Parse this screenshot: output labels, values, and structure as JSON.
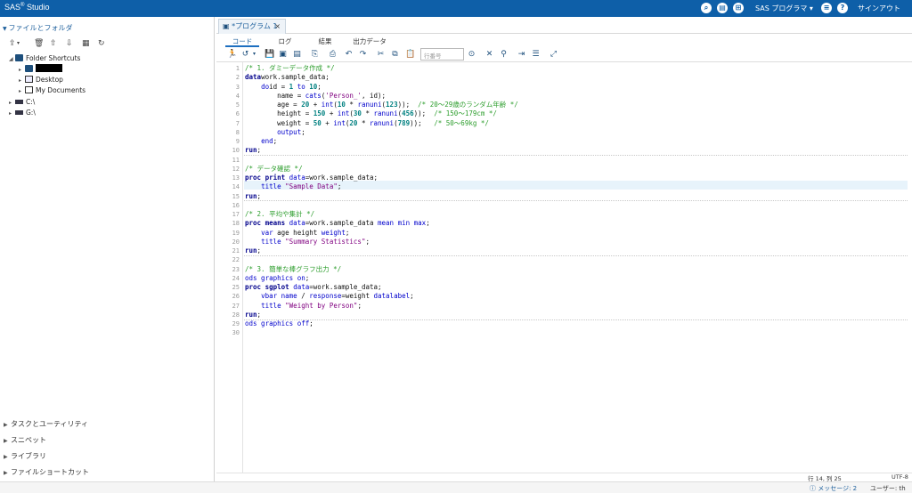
{
  "app": {
    "title": "SAS",
    "reg": "®",
    "title2": " Studio"
  },
  "top": {
    "program_menu": "SAS プログラマ ▾",
    "signout": "サインアウト",
    "icons": [
      "search-icon",
      "clipboard-icon",
      "grid-icon",
      "menu-icon",
      "help-icon"
    ]
  },
  "left": {
    "heading": "ファイルとフォルダ",
    "tree": {
      "folder_shortcuts": "Folder Shortcuts",
      "desktop": "Desktop",
      "my_documents": "My Documents",
      "c_drive": "C:\\",
      "g_drive": "G:\\"
    },
    "accordion": [
      "タスクとユーティリティ",
      "スニペット",
      "ライブラリ",
      "ファイルショートカット"
    ]
  },
  "editor_tab": {
    "title": "*プログラム 1",
    "close": "×"
  },
  "subtabs": [
    "コード",
    "ログ",
    "結果",
    "出力データ"
  ],
  "toolbar": {
    "line_placeholder": "行番号"
  },
  "status": {
    "position": "行 14, 列 25",
    "encoding": "UTF-8",
    "messages": "メッセージ: 2",
    "user": "ユーザー: th"
  },
  "code_lines": [
    [
      [
        "cm",
        "/* 1. ダミーデータ作成 */"
      ]
    ],
    [
      [
        "kw",
        "data"
      ],
      [
        "",
        "work.sample_data;"
      ]
    ],
    [
      [
        "",
        "    "
      ],
      [
        "kb",
        "do"
      ],
      [
        "",
        "id = "
      ],
      [
        "nm",
        "1"
      ],
      [
        "",
        ""
      ],
      [
        "kb",
        " to "
      ],
      [
        "nm",
        "10"
      ],
      [
        "",
        ";"
      ]
    ],
    [
      [
        "",
        "        name = "
      ],
      [
        "kb",
        "cats"
      ],
      [
        "",
        "("
      ],
      [
        "st",
        "'Person_'"
      ],
      [
        "",
        ", id);"
      ]
    ],
    [
      [
        "",
        "        age = "
      ],
      [
        "nm",
        "20"
      ],
      [
        "",
        " + "
      ],
      [
        "kb",
        "int"
      ],
      [
        "",
        "("
      ],
      [
        "nm",
        "10"
      ],
      [
        "",
        " * "
      ],
      [
        "kb",
        "ranuni"
      ],
      [
        "",
        "("
      ],
      [
        "nm",
        "123"
      ],
      [
        "",
        "));  "
      ],
      [
        "cm",
        "/* 20～29歳のランダム年齢 */"
      ]
    ],
    [
      [
        "",
        "        height = "
      ],
      [
        "nm",
        "150"
      ],
      [
        "",
        " + "
      ],
      [
        "kb",
        "int"
      ],
      [
        "",
        "("
      ],
      [
        "nm",
        "30"
      ],
      [
        "",
        " * "
      ],
      [
        "kb",
        "ranuni"
      ],
      [
        "",
        "("
      ],
      [
        "nm",
        "456"
      ],
      [
        "",
        "));  "
      ],
      [
        "cm",
        "/* 150～179cm */"
      ]
    ],
    [
      [
        "",
        "        weight = "
      ],
      [
        "nm",
        "50"
      ],
      [
        "",
        " + "
      ],
      [
        "kb",
        "int"
      ],
      [
        "",
        "("
      ],
      [
        "nm",
        "20"
      ],
      [
        "",
        " * "
      ],
      [
        "kb",
        "ranuni"
      ],
      [
        "",
        "("
      ],
      [
        "nm",
        "789"
      ],
      [
        "",
        "));   "
      ],
      [
        "cm",
        "/* 50～69kg */"
      ]
    ],
    [
      [
        "",
        "        "
      ],
      [
        "kb",
        "output"
      ],
      [
        "",
        ";"
      ]
    ],
    [
      [
        "",
        "    "
      ],
      [
        "kb",
        "end"
      ],
      [
        "",
        ";"
      ]
    ],
    [
      [
        "kw",
        "run"
      ],
      [
        "",
        ";"
      ]
    ],
    [
      [
        "",
        ""
      ]
    ],
    [
      [
        "cm",
        "/* データ確認 */"
      ]
    ],
    [
      [
        "kw",
        "proc print"
      ],
      [
        "",
        " "
      ],
      [
        "kb",
        "data"
      ],
      [
        "",
        "=work.sample_data;"
      ]
    ],
    [
      [
        "",
        "    "
      ],
      [
        "kb",
        "title"
      ],
      [
        "",
        " "
      ],
      [
        "st",
        "\"Sample Data\""
      ],
      [
        "",
        ";"
      ]
    ],
    [
      [
        "kw",
        "run"
      ],
      [
        "",
        ";"
      ]
    ],
    [
      [
        "",
        ""
      ]
    ],
    [
      [
        "cm",
        "/* 2. 平均や集計 */"
      ]
    ],
    [
      [
        "kw",
        "proc means"
      ],
      [
        "",
        " "
      ],
      [
        "kb",
        "data"
      ],
      [
        "",
        "=work.sample_data "
      ],
      [
        "kb",
        "mean min max"
      ],
      [
        "",
        ";"
      ]
    ],
    [
      [
        "",
        "    "
      ],
      [
        "kb",
        "var"
      ],
      [
        "",
        " age height "
      ],
      [
        "kb",
        "weight"
      ],
      [
        "",
        ";"
      ]
    ],
    [
      [
        "",
        "    "
      ],
      [
        "kb",
        "title"
      ],
      [
        "",
        " "
      ],
      [
        "st",
        "\"Summary Statistics\""
      ],
      [
        "",
        ";"
      ]
    ],
    [
      [
        "kw",
        "run"
      ],
      [
        "",
        ";"
      ]
    ],
    [
      [
        "",
        ""
      ]
    ],
    [
      [
        "cm",
        "/* 3. 簡単な棒グラフ出力 */"
      ]
    ],
    [
      [
        "kb",
        "ods graphics on"
      ],
      [
        "",
        ";"
      ]
    ],
    [
      [
        "kw",
        "proc sgplot"
      ],
      [
        "",
        " "
      ],
      [
        "kb",
        "data"
      ],
      [
        "",
        "=work.sample_data;"
      ]
    ],
    [
      [
        "",
        "    "
      ],
      [
        "kb",
        "vbar"
      ],
      [
        "",
        " "
      ],
      [
        "kb",
        "name"
      ],
      [
        "",
        " / "
      ],
      [
        "kb",
        "response"
      ],
      [
        "",
        "=weight "
      ],
      [
        "kb",
        "datalabel"
      ],
      [
        "",
        ";"
      ]
    ],
    [
      [
        "",
        "    "
      ],
      [
        "kb",
        "title"
      ],
      [
        "",
        " "
      ],
      [
        "st",
        "\"Weight by Person\""
      ],
      [
        "",
        ";"
      ]
    ],
    [
      [
        "kw",
        "run"
      ],
      [
        "",
        ";"
      ]
    ],
    [
      [
        "kb",
        "ods graphics off"
      ],
      [
        "",
        ";"
      ]
    ],
    [
      [
        "",
        ""
      ]
    ]
  ]
}
